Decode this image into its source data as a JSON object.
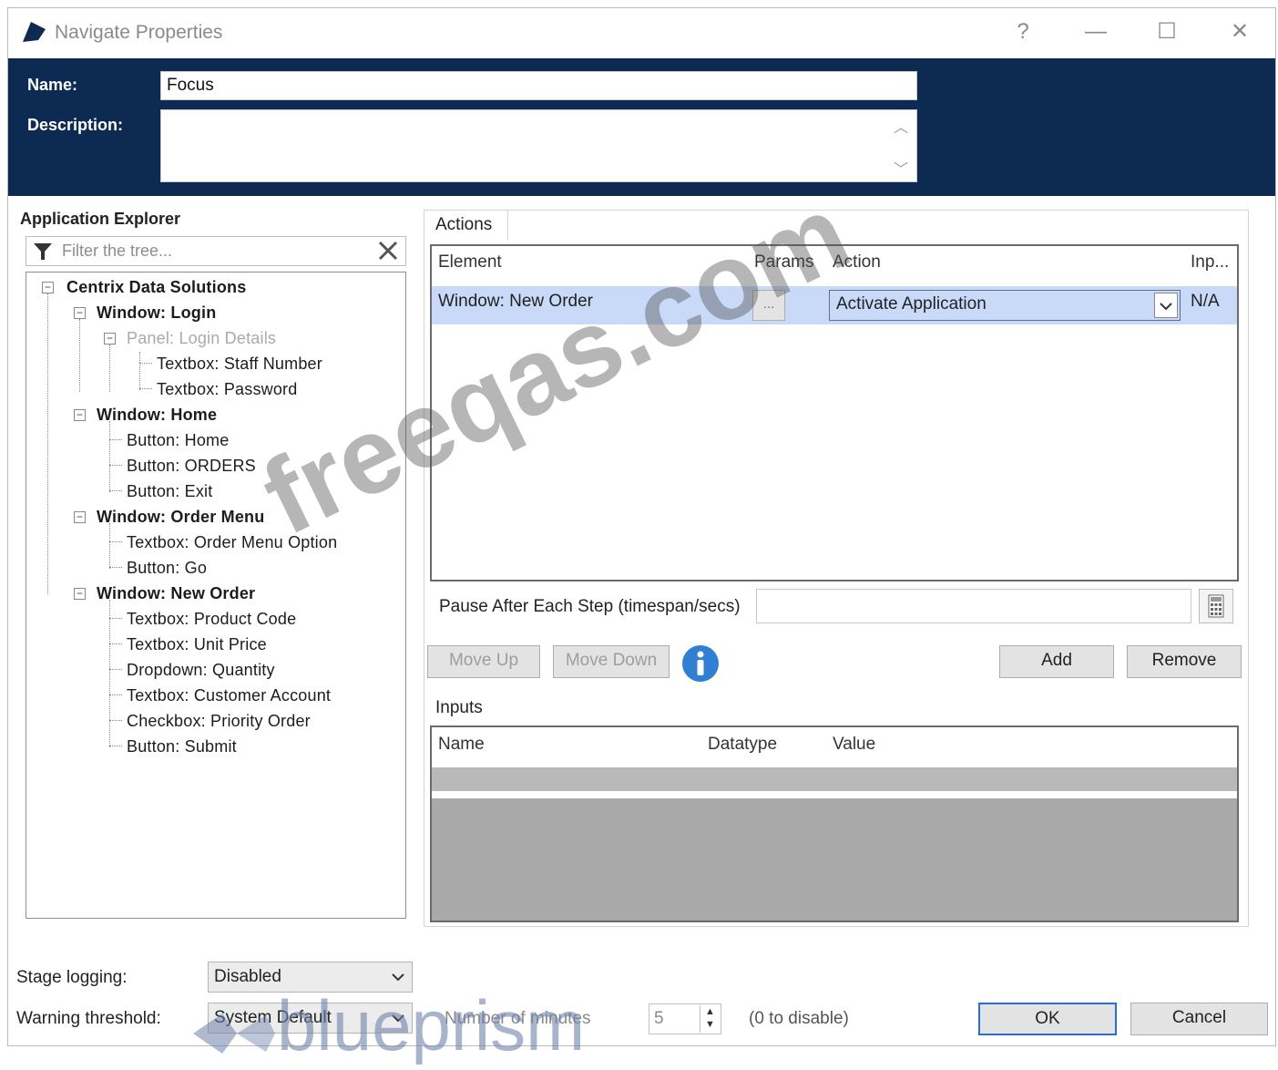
{
  "window": {
    "title": "Navigate Properties",
    "controls": {
      "help": "?",
      "minimize": "—",
      "maximize": "☐",
      "close": "✕"
    }
  },
  "header": {
    "name_label": "Name:",
    "name_value": "Focus",
    "description_label": "Description:",
    "description_value": ""
  },
  "explorer": {
    "title": "Application Explorer",
    "filter_placeholder": "Filter the tree...",
    "root": "Centrix Data Solutions",
    "nodes": [
      "Window: Login",
      "Panel: Login Details",
      "Textbox: Staff Number",
      "Textbox: Password",
      "Window: Home",
      "Button: Home",
      "Button: ORDERS",
      "Button: Exit",
      "Window: Order Menu",
      "Textbox: Order Menu Option",
      "Button: Go",
      "Window: New Order",
      "Textbox: Product Code",
      "Textbox: Unit Price",
      "Dropdown: Quantity",
      "Textbox: Customer Account",
      "Checkbox: Priority Order",
      "Button: Submit"
    ]
  },
  "actions": {
    "tab": "Actions",
    "columns": [
      "Element",
      "Params",
      "Action",
      "Inp..."
    ],
    "row": {
      "element": "Window: New Order",
      "params": "...",
      "action": "Activate Application",
      "inputs": "N/A"
    },
    "pause_label": "Pause After Each Step (timespan/secs)",
    "pause_value": "",
    "move_up": "Move Up",
    "move_down": "Move Down",
    "add": "Add",
    "remove": "Remove"
  },
  "inputs": {
    "tab": "Inputs",
    "columns": [
      "Name",
      "Datatype",
      "Value"
    ]
  },
  "footer": {
    "stage_logging_label": "Stage logging:",
    "stage_logging_value": "Disabled",
    "warning_label": "Warning threshold:",
    "warning_value": "System Default",
    "minutes_label": "Number of minutes",
    "minutes_value": "5",
    "disable_hint": "(0 to disable)",
    "ok": "OK",
    "cancel": "Cancel"
  },
  "watermarks": {
    "site": "freeqas.com",
    "brand": "blueprism"
  },
  "colors": {
    "header_bg": "#0c2a52",
    "selected_row": "#c8daf8",
    "info_icon": "#2f7fd4"
  }
}
